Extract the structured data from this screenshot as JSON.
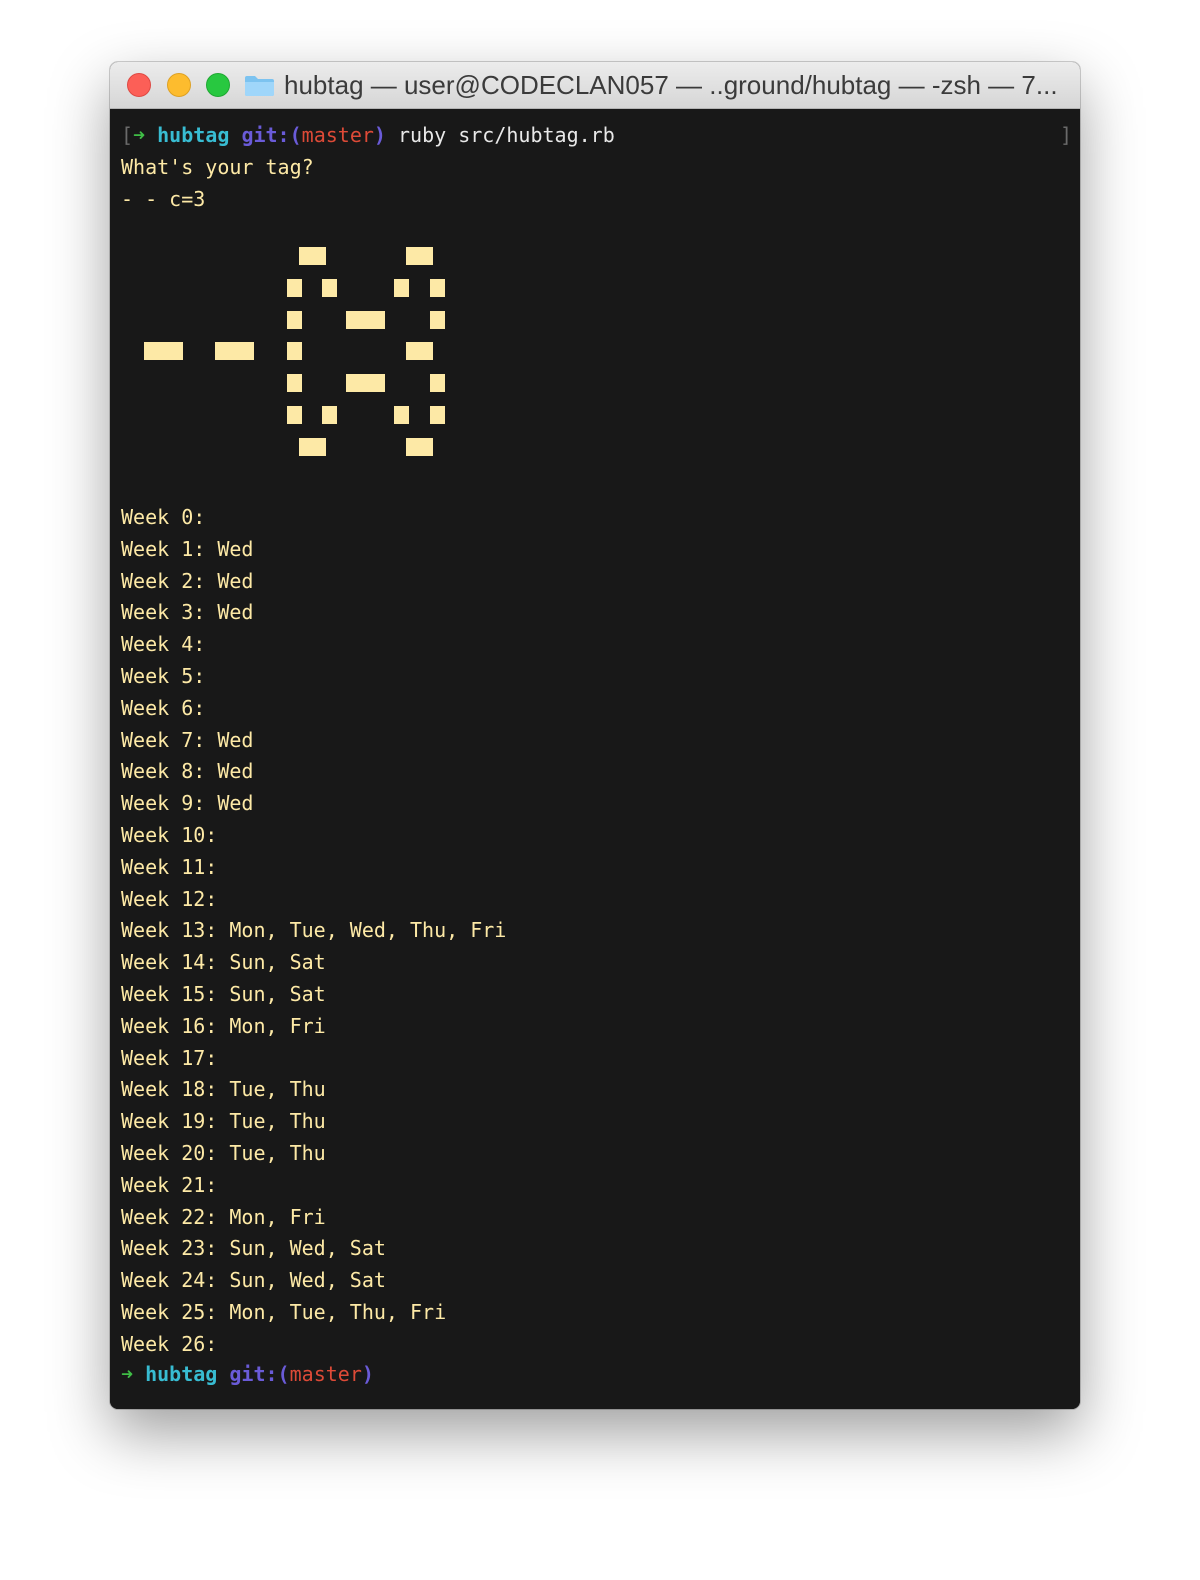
{
  "window": {
    "title": "hubtag — user@CODECLAN057 — ..ground/hubtag — -zsh — 7..."
  },
  "prompt": {
    "open_bracket": "[",
    "arrow": "➜",
    "dir": "hubtag",
    "git_label": "git:(",
    "branch": "master",
    "git_close": ")",
    "command": "ruby src/hubtag.rb",
    "close_bracket": "]"
  },
  "output": {
    "question": "What's your tag?",
    "answer": "- - c=3"
  },
  "ascii_art": {
    "text": "- - c=3",
    "color": "#fde9a6"
  },
  "weeks": [
    "Week 0:",
    "Week 1: Wed",
    "Week 2: Wed",
    "Week 3: Wed",
    "Week 4:",
    "Week 5:",
    "Week 6:",
    "Week 7: Wed",
    "Week 8: Wed",
    "Week 9: Wed",
    "Week 10:",
    "Week 11:",
    "Week 12:",
    "Week 13: Mon, Tue, Wed, Thu, Fri",
    "Week 14: Sun, Sat",
    "Week 15: Sun, Sat",
    "Week 16: Mon, Fri",
    "Week 17:",
    "Week 18: Tue, Thu",
    "Week 19: Tue, Thu",
    "Week 20: Tue, Thu",
    "Week 21:",
    "Week 22: Mon, Fri",
    "Week 23: Sun, Wed, Sat",
    "Week 24: Sun, Wed, Sat",
    "Week 25: Mon, Tue, Thu, Fri",
    "Week 26:"
  ],
  "final_prompt": {
    "arrow": "➜",
    "dir": "hubtag",
    "git_label": "git:(",
    "branch": "master",
    "git_close": ")"
  },
  "colors": {
    "terminal_bg": "#181818",
    "text": "#fde9a6",
    "arrow": "#3fbd46",
    "dir": "#38bcd2",
    "git": "#6a5bd8",
    "branch": "#dd4a37"
  },
  "icons": [
    "close-light",
    "minimize-light",
    "zoom-light",
    "folder-icon"
  ]
}
